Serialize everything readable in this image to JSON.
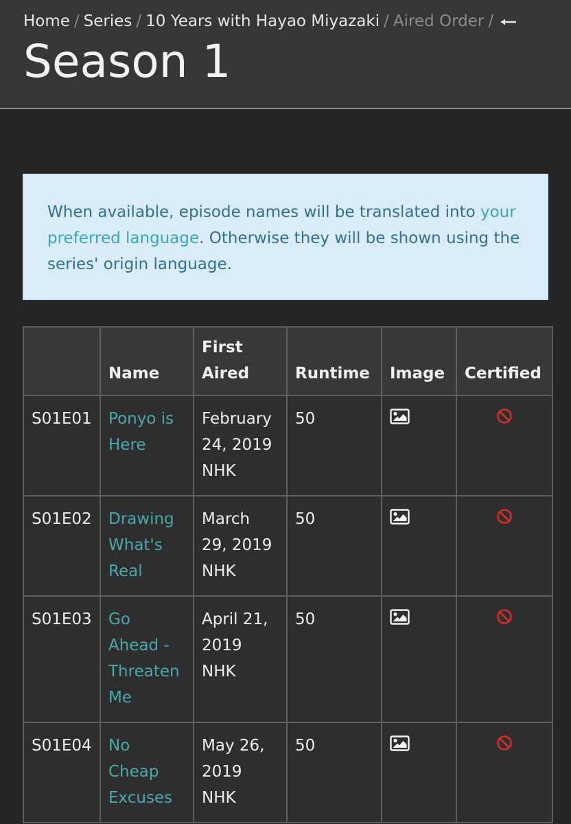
{
  "breadcrumb": {
    "home": "Home",
    "series": "Series",
    "show": "10 Years with Hayao Miyazaki",
    "order": "Aired Order",
    "separator": "/",
    "back_icon": "arrow-left-icon"
  },
  "page": {
    "title": "Season 1"
  },
  "notice": {
    "text_before": "When available, episode names will be translated into ",
    "link": "your preferred language",
    "text_after": ". Otherwise they will be shown using the series' origin language."
  },
  "table": {
    "headers": {
      "id": "",
      "name": "Name",
      "first_aired": "First Aired",
      "runtime": "Runtime",
      "image": "Image",
      "certified": "Certified"
    },
    "rows": [
      {
        "id": "S01E01",
        "name": "Ponyo is Here",
        "date": "February 24, 2019",
        "network": "NHK",
        "runtime": "50",
        "image_icon": "image-icon",
        "certified_icon": "not-certified-icon"
      },
      {
        "id": "S01E02",
        "name": "Drawing What's Real",
        "date": "March 29, 2019",
        "network": "NHK",
        "runtime": "50",
        "image_icon": "image-icon",
        "certified_icon": "not-certified-icon"
      },
      {
        "id": "S01E03",
        "name": "Go Ahead - Threaten Me",
        "date": "April 21, 2019",
        "network": "NHK",
        "runtime": "50",
        "image_icon": "image-icon",
        "certified_icon": "not-certified-icon"
      },
      {
        "id": "S01E04",
        "name": "No Cheap Excuses",
        "date": "May 26, 2019",
        "network": "NHK",
        "runtime": "50",
        "image_icon": "image-icon",
        "certified_icon": "not-certified-icon"
      }
    ]
  },
  "colors": {
    "background": "#262626",
    "header": "#363636",
    "link": "#4aa9ad",
    "notice_bg": "#d9ecf7",
    "notice_text": "#31708f",
    "danger": "#c9302c"
  }
}
